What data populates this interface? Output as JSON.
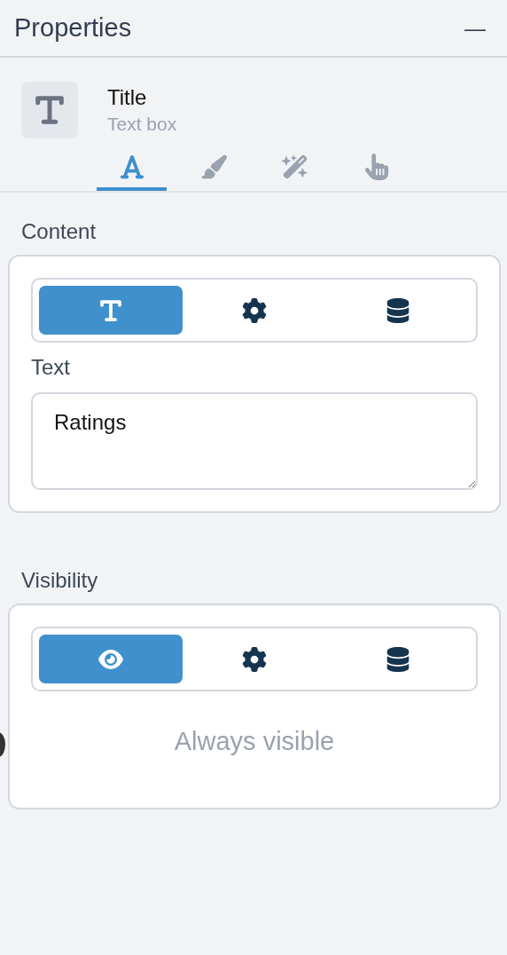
{
  "panel": {
    "title": "Properties",
    "collapse_symbol": "—"
  },
  "element": {
    "name": "Title",
    "type": "Text box"
  },
  "tabs": [
    {
      "kind": "font",
      "selected": true
    },
    {
      "kind": "brush",
      "selected": false
    },
    {
      "kind": "magic",
      "selected": false
    },
    {
      "kind": "pointer",
      "selected": false
    }
  ],
  "sections": [
    {
      "title": "Content",
      "options": [
        {
          "kind": "text",
          "selected": true
        },
        {
          "kind": "gear",
          "selected": false
        },
        {
          "kind": "database",
          "selected": false
        }
      ],
      "field_label": "Text",
      "value": "Ratings"
    },
    {
      "title": "Visibility",
      "options": [
        {
          "kind": "eye",
          "selected": true
        },
        {
          "kind": "gear",
          "selected": false
        },
        {
          "kind": "database",
          "selected": false
        }
      ],
      "note": "Always visible"
    }
  ]
}
